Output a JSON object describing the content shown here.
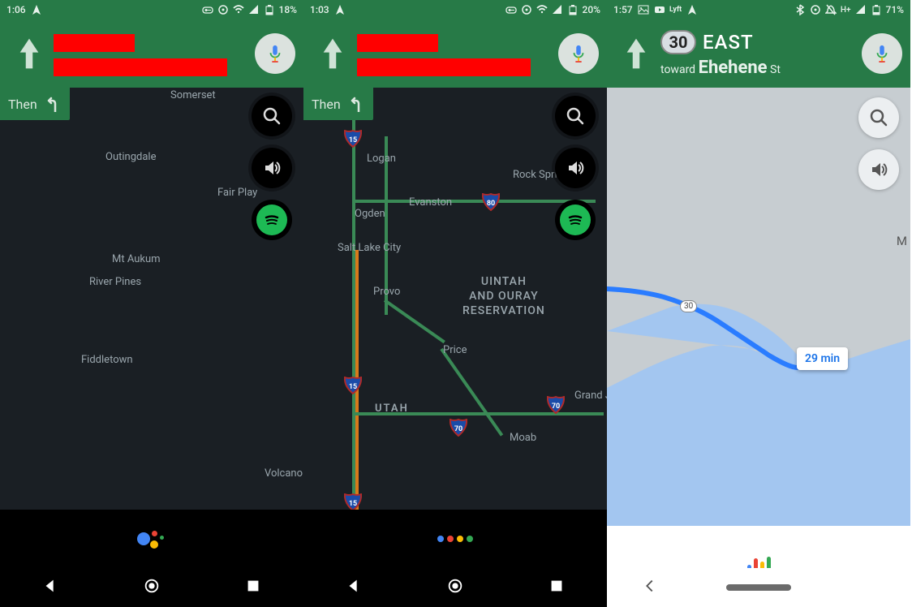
{
  "phones": [
    {
      "statusbar": {
        "time": "1:06",
        "battery": "18%"
      },
      "then_label": "Then",
      "map_labels": {
        "somerset": "Somerset",
        "outingdale": "Outingdale",
        "fairplay": "Fair Play",
        "mtaukum": "Mt Aukum",
        "riverpines": "River Pines",
        "fiddletown": "Fiddletown",
        "volcano": "Volcano"
      },
      "assistant_variant": "orb"
    },
    {
      "statusbar": {
        "time": "1:03",
        "battery": "20%"
      },
      "then_label": "Then",
      "map_labels": {
        "logan": "Logan",
        "rocksprings": "Rock Springs",
        "evanston": "Evanston",
        "ogden": "Ogden",
        "slc": "Salt Lake City",
        "provo": "Provo",
        "price": "Price",
        "utah": "UTAH",
        "moab": "Moab",
        "grandjun": "Grand Junction",
        "reservation": "UINTAH\nAND OURAY\nRESERVATION",
        "hw15": "15",
        "hw80": "80",
        "hw70": "70"
      },
      "assistant_variant": "dots"
    },
    {
      "statusbar": {
        "time": "1:57",
        "battery": "71%"
      },
      "direction": {
        "route_num": "30",
        "heading": "EAST",
        "toward_prefix": "toward",
        "toward_main": "Ehehene",
        "toward_suffix": "St"
      },
      "map_labels": {
        "shield30": "30",
        "eta": "29 min",
        "m_edge": "M"
      },
      "assistant_variant": "bars"
    }
  ],
  "icons": {
    "nav_arrow": "nav-arrow-icon",
    "mic": "mic-icon",
    "search": "search-icon",
    "volume": "volume-icon",
    "spotify": "spotify-icon",
    "turn_left": "turn-left-icon",
    "back": "back-icon",
    "home": "home-icon",
    "recent": "recent-icon",
    "vpn": "vpn-icon",
    "location": "location-icon",
    "wifi": "wifi-icon",
    "signal": "signal-icon",
    "battery": "battery-icon",
    "bt": "bluetooth-icon",
    "silent": "silent-icon",
    "hplus": "hplus-icon",
    "youtube": "youtube-icon",
    "image": "image-icon",
    "lyft": "lyft-icon"
  },
  "colors": {
    "green_header": "#277a47",
    "fab_dark": "#000000",
    "spotify_green": "#1db954",
    "google_blue": "#4285f4",
    "google_red": "#ea4335",
    "google_yellow": "#fbbc05",
    "google_green": "#34a853",
    "route_blue": "#2a7cff"
  }
}
